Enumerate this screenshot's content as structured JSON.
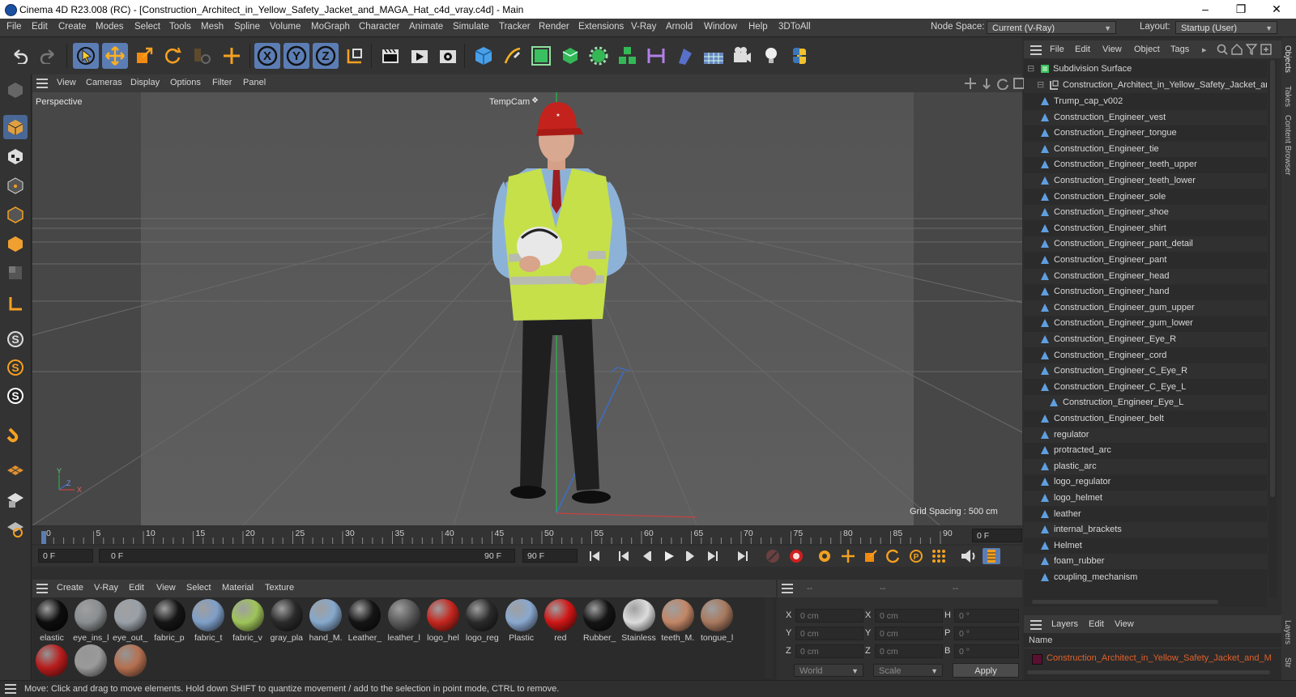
{
  "window": {
    "title": "Cinema 4D R23.008 (RC) - [Construction_Architect_in_Yellow_Safety_Jacket_and_MAGA_Hat_c4d_vray.c4d] - Main"
  },
  "menu": [
    "File",
    "Edit",
    "Create",
    "Modes",
    "Select",
    "Tools",
    "Mesh",
    "Spline",
    "Volume",
    "MoGraph",
    "Character",
    "Animate",
    "Simulate",
    "Tracker",
    "Render",
    "Extensions",
    "V-Ray",
    "Arnold",
    "Window",
    "Help",
    "3DToAll"
  ],
  "node_space": {
    "label": "Node Space:",
    "value": "Current (V-Ray)"
  },
  "layout": {
    "label": "Layout:",
    "value": "Startup (User)"
  },
  "viewport": {
    "menu": [
      "View",
      "Cameras",
      "Display",
      "Options",
      "Filter",
      "Panel"
    ],
    "label": "Perspective",
    "camera": "TempCam",
    "grid_spacing": "Grid Spacing : 500 cm",
    "axis_y": "Y",
    "axis_z": "Z",
    "axis_x": "X"
  },
  "timeline": {
    "ticks": [
      "0",
      "5",
      "10",
      "15",
      "20",
      "25",
      "30",
      "35",
      "40",
      "45",
      "50",
      "55",
      "60",
      "65",
      "70",
      "75",
      "80",
      "85",
      "90"
    ],
    "current_frame": "0 F",
    "start": "0 F",
    "range_start": "0 F",
    "range_end": "90 F",
    "end": "90 F"
  },
  "materials": {
    "menu": [
      "Create",
      "V-Ray",
      "Edit",
      "View",
      "Select",
      "Material",
      "Texture"
    ],
    "items": [
      {
        "label": "elastic",
        "color": "#0d0d0d"
      },
      {
        "label": "eye_ins_l",
        "color": "#8a8e90"
      },
      {
        "label": "eye_out_",
        "color": "#9aa0a8"
      },
      {
        "label": "fabric_p",
        "color": "#151515"
      },
      {
        "label": "fabric_t",
        "color": "#7f9fc8"
      },
      {
        "label": "fabric_v",
        "color": "#9fc45a"
      },
      {
        "label": "gray_pla",
        "color": "#2a2a2a"
      },
      {
        "label": "hand_M.",
        "color": "#86a8cc"
      },
      {
        "label": "Leather_",
        "color": "#151515"
      },
      {
        "label": "leather_l",
        "color": "#5a5a5a"
      },
      {
        "label": "logo_hel",
        "color": "#c4261e"
      },
      {
        "label": "logo_reg",
        "color": "#2a2a2a"
      },
      {
        "label": "Plastic",
        "color": "#8aa8cf"
      },
      {
        "label": "red",
        "color": "#d01616"
      },
      {
        "label": "Rubber_",
        "color": "#141414"
      },
      {
        "label": "Stainless",
        "color": "#dcdcdc"
      },
      {
        "label": "teeth_M.",
        "color": "#c28666"
      },
      {
        "label": "tongue_l",
        "color": "#a8795e"
      }
    ],
    "row2": [
      {
        "color": "#b81c1c"
      },
      {
        "color": "#9a9a9a"
      },
      {
        "color": "#b57050"
      }
    ]
  },
  "coordinates": {
    "header": [
      "--",
      "--",
      "--"
    ],
    "rows": [
      {
        "l1": "X",
        "v1": "0 cm",
        "l2": "X",
        "v2": "0 cm",
        "l3": "H",
        "v3": "0 °"
      },
      {
        "l1": "Y",
        "v1": "0 cm",
        "l2": "Y",
        "v2": "0 cm",
        "l3": "P",
        "v3": "0 °"
      },
      {
        "l1": "Z",
        "v1": "0 cm",
        "l2": "Z",
        "v2": "0 cm",
        "l3": "B",
        "v3": "0 °"
      }
    ],
    "mode1": "World",
    "mode2": "Scale",
    "apply": "Apply"
  },
  "objects": {
    "menu": [
      "File",
      "Edit",
      "View",
      "Object",
      "Tags"
    ],
    "root": "Subdivision Surface",
    "group": "Construction_Architect_in_Yellow_Safety_Jacket_and",
    "items": [
      "Trump_cap_v002",
      "Construction_Engineer_vest",
      "Construction_Engineer_tongue",
      "Construction_Engineer_tie",
      "Construction_Engineer_teeth_upper",
      "Construction_Engineer_teeth_lower",
      "Construction_Engineer_sole",
      "Construction_Engineer_shoe",
      "Construction_Engineer_shirt",
      "Construction_Engineer_pant_detail",
      "Construction_Engineer_pant",
      "Construction_Engineer_head",
      "Construction_Engineer_hand",
      "Construction_Engineer_gum_upper",
      "Construction_Engineer_gum_lower",
      "Construction_Engineer_Eye_R",
      "Construction_Engineer_cord",
      "Construction_Engineer_C_Eye_R",
      "Construction_Engineer_C_Eye_L"
    ],
    "child": "Construction_Engineer_Eye_L",
    "items2": [
      "Construction_Engineer_belt",
      "regulator",
      "protracted_arc",
      "plastic_arc",
      "logo_regulator",
      "logo_helmet",
      "leather",
      "internal_brackets",
      "Helmet",
      "foam_rubber",
      "coupling_mechanism"
    ]
  },
  "layers": {
    "menu": [
      "Layers",
      "Edit",
      "View"
    ],
    "column": "Name",
    "item": "Construction_Architect_in_Yellow_Safety_Jacket_and_M"
  },
  "side_tabs": [
    "Objects",
    "Takes",
    "Content Browser",
    "Layers",
    "Str"
  ],
  "status": "Move: Click and drag to move elements. Hold down SHIFT to quantize movement / add to the selection in point mode, CTRL to remove.",
  "colors": {
    "accent": "#5b7db4",
    "vest": "#c6e04a",
    "hat": "#c4221c",
    "layer_text": "#e0602a"
  }
}
